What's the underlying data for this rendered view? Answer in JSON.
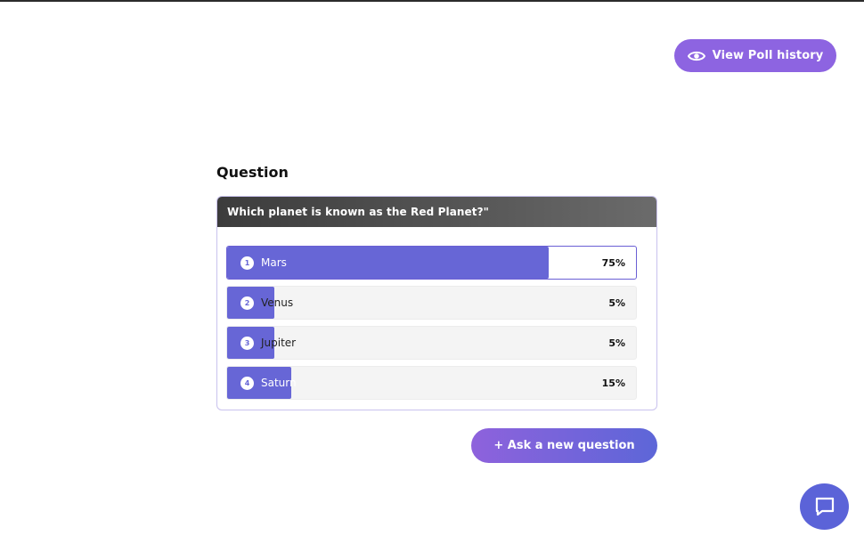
{
  "header": {
    "history_button_label": "View Poll history",
    "history_icon": "eye-icon"
  },
  "question": {
    "heading": "Question",
    "text": "Which planet is known as the Red Planet?\""
  },
  "poll": {
    "options": [
      {
        "number": "1",
        "label": "Mars",
        "percent_label": "75%",
        "percent": 75,
        "selected": true
      },
      {
        "number": "2",
        "label": "Venus",
        "percent_label": "5%",
        "percent": 5,
        "selected": false
      },
      {
        "number": "3",
        "label": "Jupiter",
        "percent_label": "5%",
        "percent": 5,
        "selected": false
      },
      {
        "number": "4",
        "label": "Saturn",
        "percent_label": "15%",
        "percent": 15,
        "selected": false
      }
    ]
  },
  "actions": {
    "ask_button_label": "+ Ask a new question"
  },
  "chat": {
    "icon": "chat-bubble-icon"
  },
  "colors": {
    "accent_purple": "#8d64e1",
    "bar_fill": "#6766d6",
    "header_dark": "#4a4a4a",
    "chat_blue": "#5b63d8"
  }
}
